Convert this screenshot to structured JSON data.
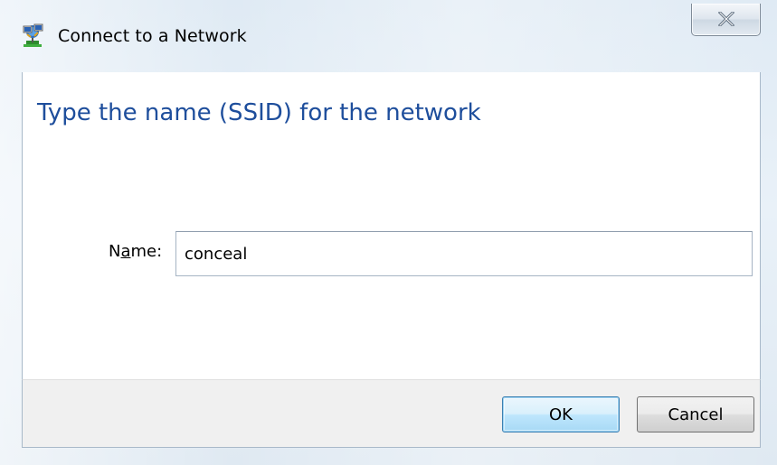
{
  "window": {
    "title": "Connect to a Network",
    "title_icon": "network-connect-icon",
    "close_icon": "close-icon"
  },
  "content": {
    "heading": "Type the name (SSID) for the network",
    "name_label_prefix": "N",
    "name_label_accel": "a",
    "name_label_suffix": "me:",
    "name_value": "conceal"
  },
  "footer": {
    "ok_label": "OK",
    "cancel_label": "Cancel"
  },
  "colors": {
    "heading": "#1e4e9c",
    "ok_border": "#3c7fb1"
  }
}
